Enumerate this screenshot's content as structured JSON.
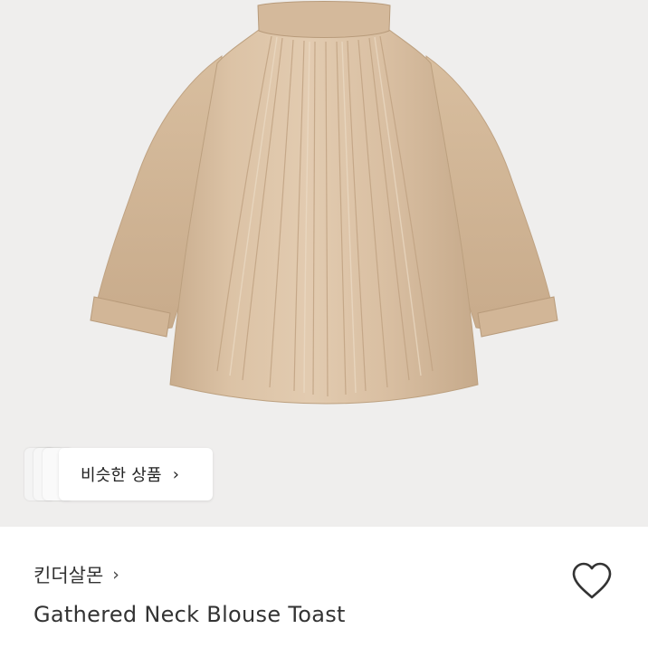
{
  "product_image": {
    "icon": "gathered-neck-blouse-image",
    "background_color": "#efeeed",
    "garment_color": "#d6bb9d"
  },
  "similar_products": {
    "label": "비슷한 상품",
    "chevron": "›"
  },
  "store": {
    "name": "킨더살몬",
    "chevron": "›"
  },
  "product": {
    "title": "Gathered Neck Blouse Toast"
  },
  "wishlist": {
    "icon": "heart-outline-icon"
  }
}
